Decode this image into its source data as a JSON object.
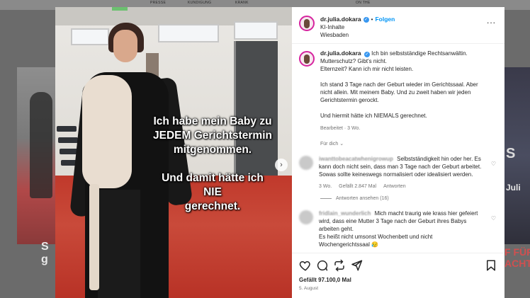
{
  "background": {
    "top_labels": [
      "PRESSE",
      "KUNDIGUNG",
      "KRANK",
      "ON THE"
    ],
    "left_text": "S\ng",
    "right_text_1": "S",
    "right_text_2": "Juli",
    "right_text_3": "F FÜR\nACHT"
  },
  "photo": {
    "overlay_line1": "Ich habe mein Baby zu",
    "overlay_line2": "JEDEM Gerichtstermin",
    "overlay_line3": "mitgenommen.",
    "overlay_line4": "Und damit hätte ich",
    "overlay_line5": "NIE",
    "overlay_line6": "gerechnet.",
    "next_icon": "chevron-right-icon"
  },
  "header": {
    "username": "dr.julia.dokara",
    "separator": "•",
    "follow_label": "Folgen",
    "subtitle": "KI-Inhalte",
    "location": "Wiesbaden",
    "more_label": "..."
  },
  "caption": {
    "username": "dr.julia.dokara",
    "line1": "Ich bin selbstständige Rechtsanwältin.",
    "line2": "Mutterschutz? Gibt's nicht.",
    "line3": "Elternzeit? Kann ich mir nicht leisten.",
    "para2": "Ich stand 3 Tage nach der Geburt wieder im Gerichtssaal. Aber nicht allein. Mit meinem Baby. Und zu zweit haben wir jeden Gerichtstermin gerockt.",
    "para3": "Und hiermit hätte ich NIEMALS gerechnet.",
    "meta": "Bearbeitet · 3 Wo.",
    "translate_label": "Für dich",
    "translate_icon": "⌄"
  },
  "comments": [
    {
      "username": "iwanttobeacatwhenigrowup",
      "text": "Selbstständigkeit hin oder her. Es kann doch nicht sein, dass man 3 Tage nach der Geburt arbeitet. Sowas sollte keineswegs normalisiert oder idealisiert werden.",
      "age": "3 Wo.",
      "likes": "Gefällt 2.847 Mal",
      "reply_label": "Antworten",
      "view_replies": "Antworten ansehen (16)"
    },
    {
      "username": "fridlain_wunderlich",
      "text": "Mich macht traurig wie krass hier gefeiert wird, dass eine Mutter 3 Tage nach der Geburt ihres Babys arbeiten geht.",
      "text2": "Es heißt nicht umsonst Wochenbett und nicht Wochengerichtssaal 😥"
    }
  ],
  "footer": {
    "likes": "Gefällt 97.100,0 Mal",
    "date": "5. August"
  }
}
